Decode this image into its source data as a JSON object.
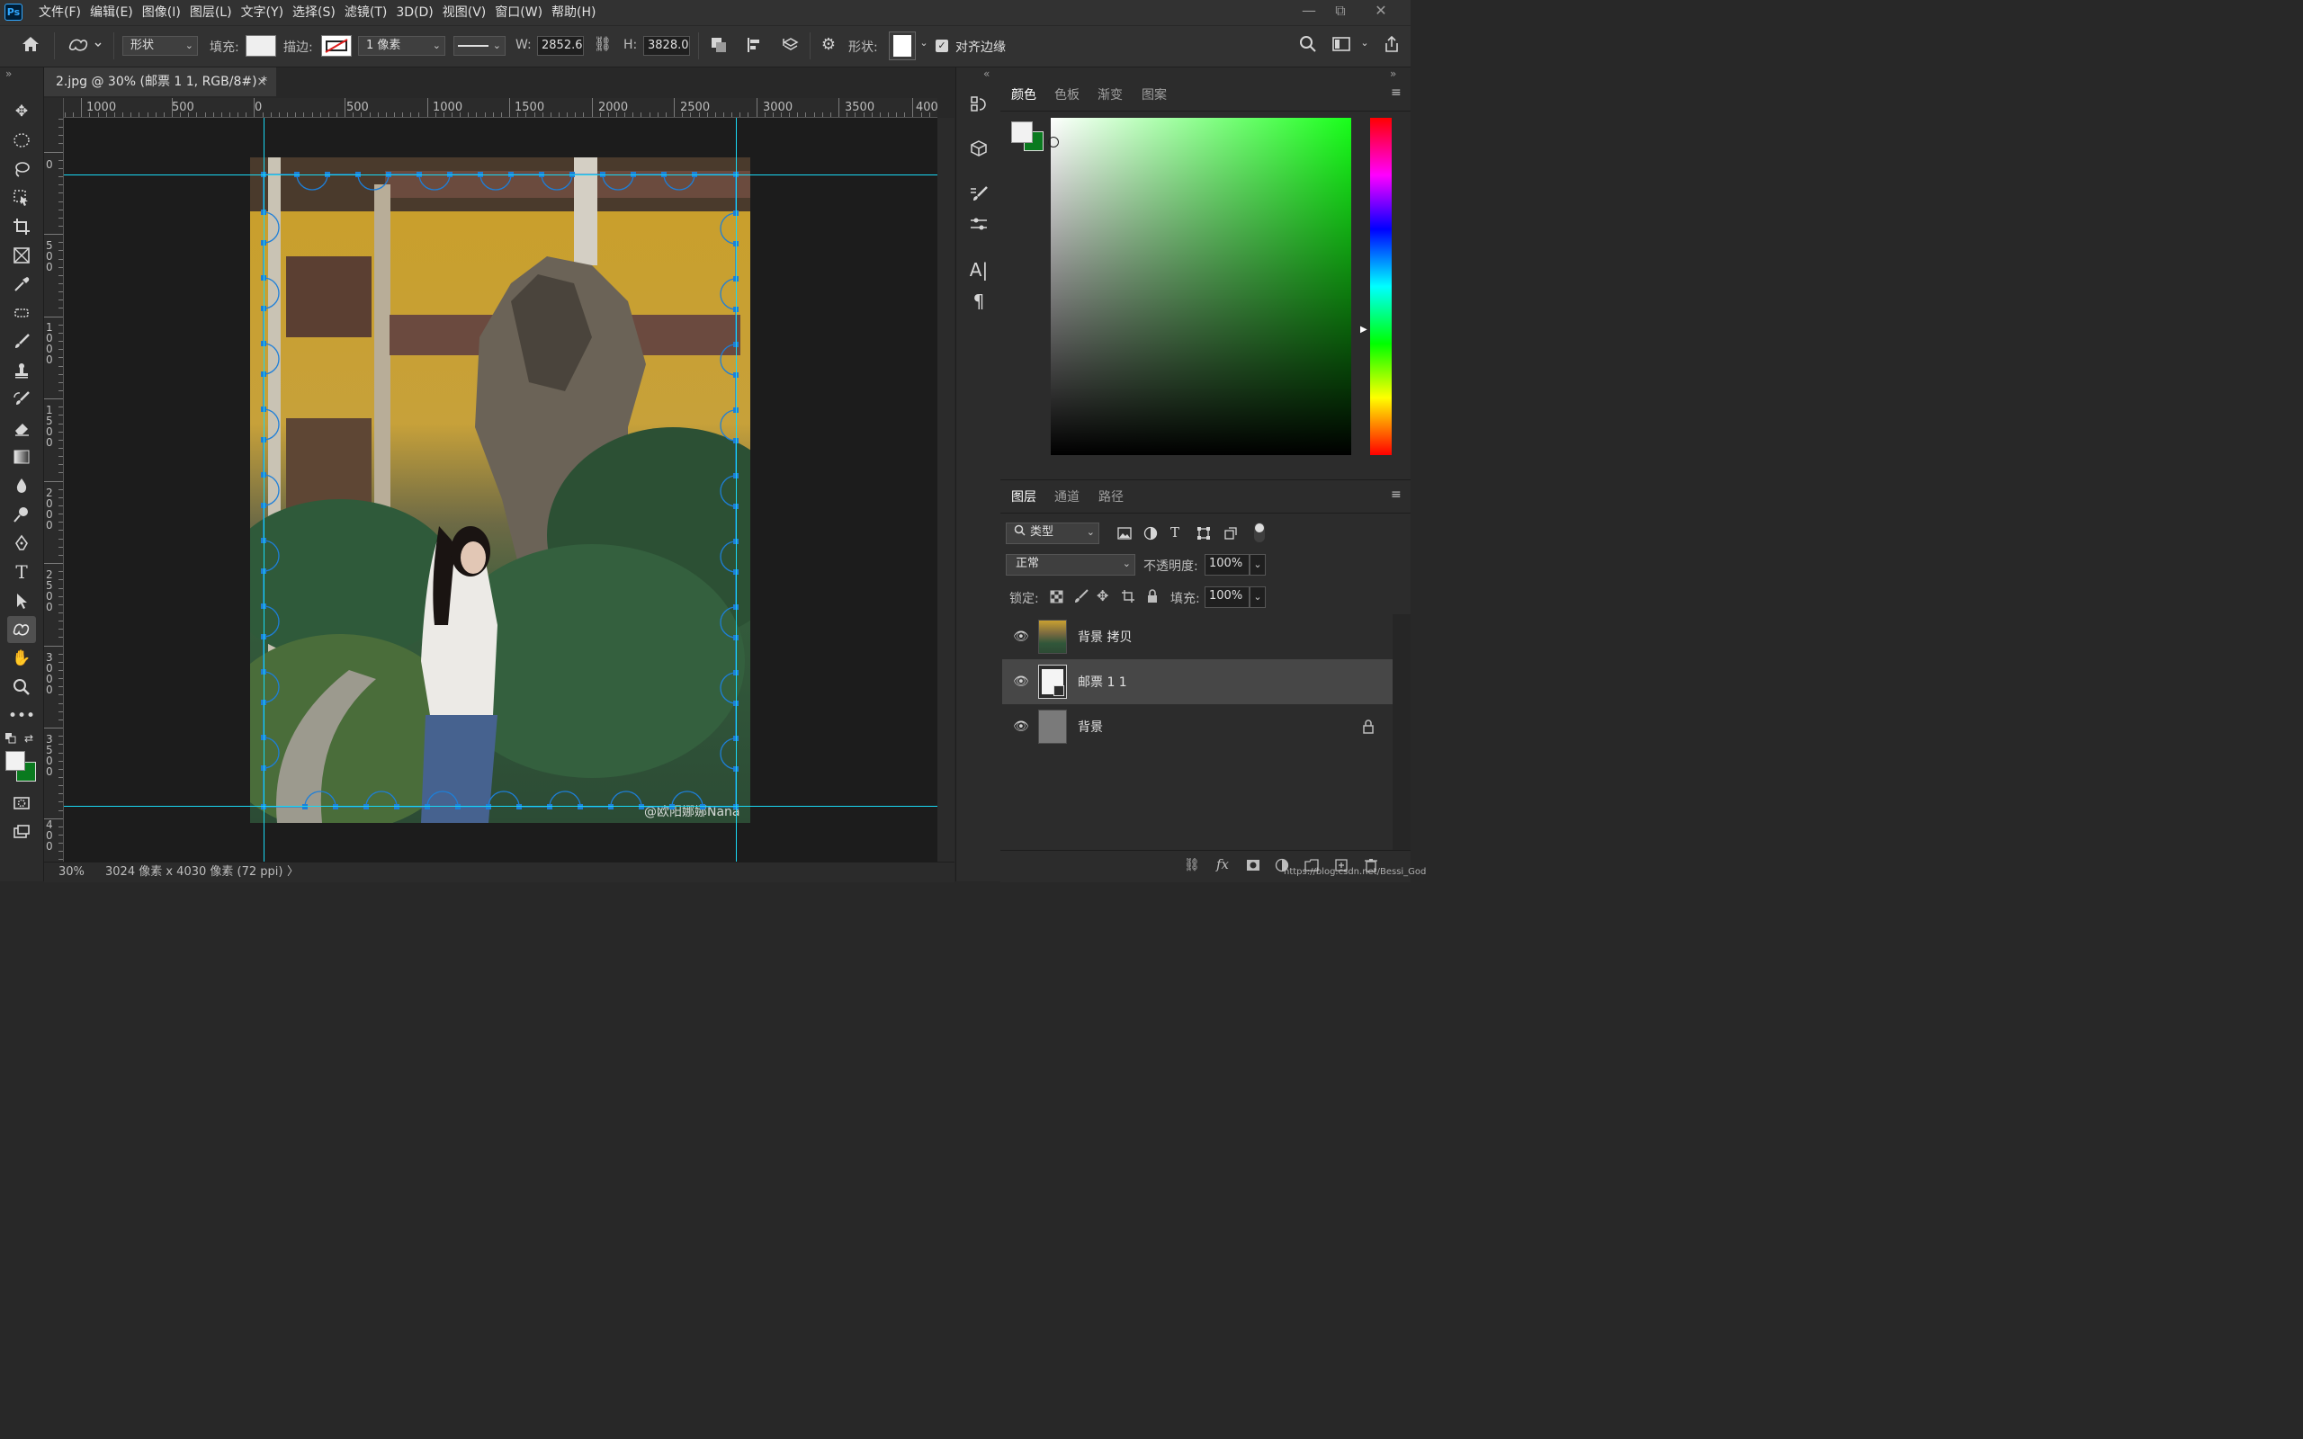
{
  "app": {
    "logo": "Ps"
  },
  "menu": [
    "文件(F)",
    "编辑(E)",
    "图像(I)",
    "图层(L)",
    "文字(Y)",
    "选择(S)",
    "滤镜(T)",
    "3D(D)",
    "视图(V)",
    "窗口(W)",
    "帮助(H)"
  ],
  "window_controls": {
    "minimize": "—",
    "restore": "⧉",
    "close": "✕"
  },
  "options": {
    "mode": "形状",
    "fill_label": "填充:",
    "stroke_label": "描边:",
    "stroke_width": "1 像素",
    "w_label": "W:",
    "w_value": "2852.6",
    "h_label": "H:",
    "h_value": "3828.0",
    "shape_label": "形状:",
    "align_edges_label": "对齐边缘",
    "align_edges_checked": true
  },
  "document": {
    "tab_title": "2.jpg @ 30% (邮票 1 1, RGB/8#) *",
    "close": "×"
  },
  "rulers": {
    "top_labels": [
      "1000",
      "500",
      "0",
      "500",
      "1000",
      "1500",
      "2000",
      "2500",
      "3000",
      "3500",
      "400"
    ],
    "left_labels": [
      "0",
      "5\n0\n0",
      "1\n0\n0\n0",
      "1\n5\n0\n0",
      "2\n0\n0\n0",
      "2\n5\n0\n0",
      "3\n0\n0\n0",
      "3\n5\n0\n0",
      "4\n0\n0"
    ]
  },
  "status": {
    "zoom": "30%",
    "info": "3024 像素 x 4030 像素 (72 ppi)",
    "arrow": "〉"
  },
  "photo": {
    "watermark": "@欧阳娜娜Nana"
  },
  "color_panel": {
    "tabs": [
      "颜色",
      "色板",
      "渐变",
      "图案"
    ],
    "active_tab": "颜色",
    "foreground": "#f2f2f2",
    "background": "#0a7a1f",
    "hue_color": "#18ff1a"
  },
  "layers_panel": {
    "tabs": [
      "图层",
      "通道",
      "路径"
    ],
    "active_tab": "图层",
    "filter_kind": "类型",
    "blend_mode": "正常",
    "opacity_label": "不透明度:",
    "opacity": "100%",
    "lock_label": "锁定:",
    "fill_label": "填充:",
    "fill": "100%",
    "layers": [
      {
        "name": "背景 拷贝",
        "selected": false,
        "locked": false
      },
      {
        "name": "邮票 1 1",
        "selected": true,
        "locked": false
      },
      {
        "name": "背景",
        "selected": false,
        "locked": true
      }
    ]
  },
  "footer_url": "https://blog.csdn.net/Bessi_God"
}
